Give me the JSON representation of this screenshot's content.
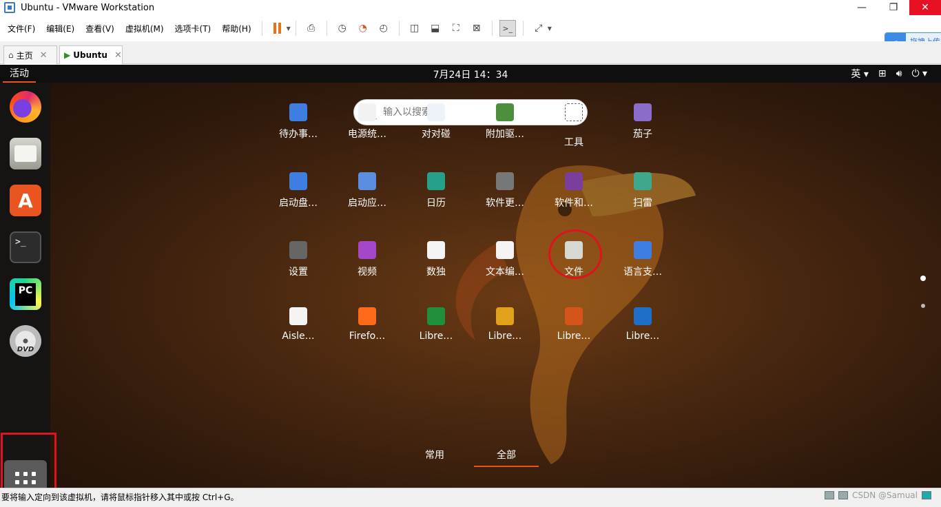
{
  "window": {
    "title": "Ubuntu - VMware Workstation",
    "minimize": "—",
    "maximize": "❐",
    "close": "✕"
  },
  "menu": [
    "文件(F)",
    "编辑(E)",
    "查看(V)",
    "虚拟机(M)",
    "选项卡(T)",
    "帮助(H)"
  ],
  "baidu_widget": "拖拽上传",
  "tabs": [
    {
      "label": "主页"
    },
    {
      "label": "Ubuntu"
    }
  ],
  "guest": {
    "activities": "活动",
    "clock": "7月24日  14：34",
    "input_method": "英 ▾",
    "search": {
      "placeholder": "输入以搜索"
    },
    "apps": [
      {
        "label": "待办事…",
        "icon": "todo-icon",
        "color": "#3d7ee0"
      },
      {
        "label": "电源统…",
        "icon": "power-stats-icon",
        "color": "#f2f2f2"
      },
      {
        "label": "对对碰",
        "icon": "mahjongg-icon",
        "color": "#eef3fa"
      },
      {
        "label": "附加驱…",
        "icon": "drivers-icon",
        "color": "#4d8f3d"
      },
      {
        "label": "工具",
        "icon": "utilities-folder-icon",
        "color": "#444"
      },
      {
        "label": "茄子",
        "icon": "cheese-icon",
        "color": "#8c6cc9"
      },
      {
        "label": "启动盘…",
        "icon": "startup-disk-icon",
        "color": "#3d7ee0"
      },
      {
        "label": "启动应…",
        "icon": "startup-apps-icon",
        "color": "#5c8de0"
      },
      {
        "label": "日历",
        "icon": "calendar-icon",
        "color": "#27a08a"
      },
      {
        "label": "软件更…",
        "icon": "software-updater-icon",
        "color": "#777"
      },
      {
        "label": "软件和…",
        "icon": "software-properties-icon",
        "color": "#7a3f9c"
      },
      {
        "label": "扫雷",
        "icon": "mines-icon",
        "color": "#3fa88c"
      },
      {
        "label": "设置",
        "icon": "settings-icon",
        "color": "#666"
      },
      {
        "label": "视频",
        "icon": "videos-icon",
        "color": "#a447c9"
      },
      {
        "label": "数独",
        "icon": "sudoku-icon",
        "color": "#f4f4f4"
      },
      {
        "label": "文本编…",
        "icon": "text-editor-icon",
        "color": "#f4f4f4"
      },
      {
        "label": "文件",
        "icon": "files-icon",
        "color": "#d8d8d2"
      },
      {
        "label": "语言支…",
        "icon": "language-support-icon",
        "color": "#3d7ee0"
      },
      {
        "label": "Aisle…",
        "icon": "aisleriot-icon",
        "color": "#f4f4f4"
      },
      {
        "label": "Firefo…",
        "icon": "firefox-icon",
        "color": "#ff6a1a"
      },
      {
        "label": "Libre…",
        "icon": "libreoffice-calc-icon",
        "color": "#1f8f3a"
      },
      {
        "label": "Libre…",
        "icon": "libreoffice-draw-icon",
        "color": "#e0a21a"
      },
      {
        "label": "Libre…",
        "icon": "libreoffice-impress-icon",
        "color": "#d4541a"
      },
      {
        "label": "Libre…",
        "icon": "libreoffice-writer-icon",
        "color": "#1f6fc9"
      }
    ],
    "bottom_tabs": {
      "frequent": "常用",
      "all": "全部"
    },
    "dock": [
      "firefox-icon",
      "files-icon",
      "software-store-icon",
      "terminal-icon",
      "pycharm-icon",
      "dvd-icon"
    ]
  },
  "statusbar": {
    "message": "要将输入定向到该虚拟机，请将鼠标指针移入其中或按 Ctrl+G。",
    "watermark": "CSDN @Samual"
  }
}
